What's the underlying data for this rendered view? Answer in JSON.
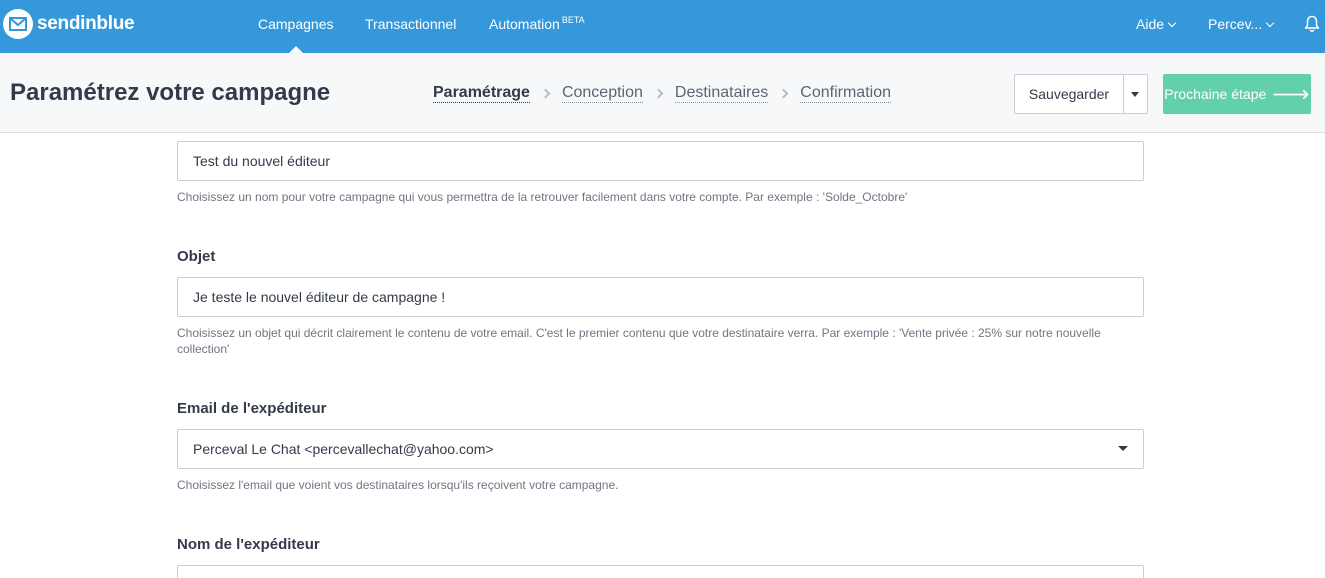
{
  "app": {
    "brand": "sendinblue",
    "nav": {
      "campagnes": "Campagnes",
      "transactionnel": "Transactionnel",
      "automation": "Automation",
      "automation_badge": "BETA",
      "aide": "Aide",
      "user": "Percev..."
    }
  },
  "header": {
    "title": "Paramétrez votre campagne",
    "steps": [
      "Paramétrage",
      "Conception",
      "Destinataires",
      "Confirmation"
    ],
    "current_step": "Paramétrage",
    "save_label": "Sauvegarder",
    "next_label": "Prochaine étape"
  },
  "form": {
    "campaign_name": {
      "value": "Test du nouvel éditeur",
      "help": "Choisissez un nom pour votre campagne qui vous permettra de la retrouver facilement dans votre compte. Par exemple : 'Solde_Octobre'"
    },
    "subject": {
      "label": "Objet",
      "value": "Je teste le nouvel éditeur de campagne !",
      "help": "Choisissez un objet qui décrit clairement le contenu de votre email. C'est le premier contenu que votre destinataire verra. Par exemple : 'Vente privée : 25% sur notre nouvelle collection'"
    },
    "sender_email": {
      "label": "Email de l'expéditeur",
      "value": "Perceval Le Chat <percevallechat@yahoo.com>",
      "help": "Choisissez l'email que voient vos destinataires lorsqu'ils reçoivent votre campagne."
    },
    "sender_name": {
      "label": "Nom de l'expéditeur"
    }
  },
  "colors": {
    "navbar": "#3598da",
    "primary_button": "#62d0a8",
    "subheader_bg": "#f7f8fa"
  }
}
